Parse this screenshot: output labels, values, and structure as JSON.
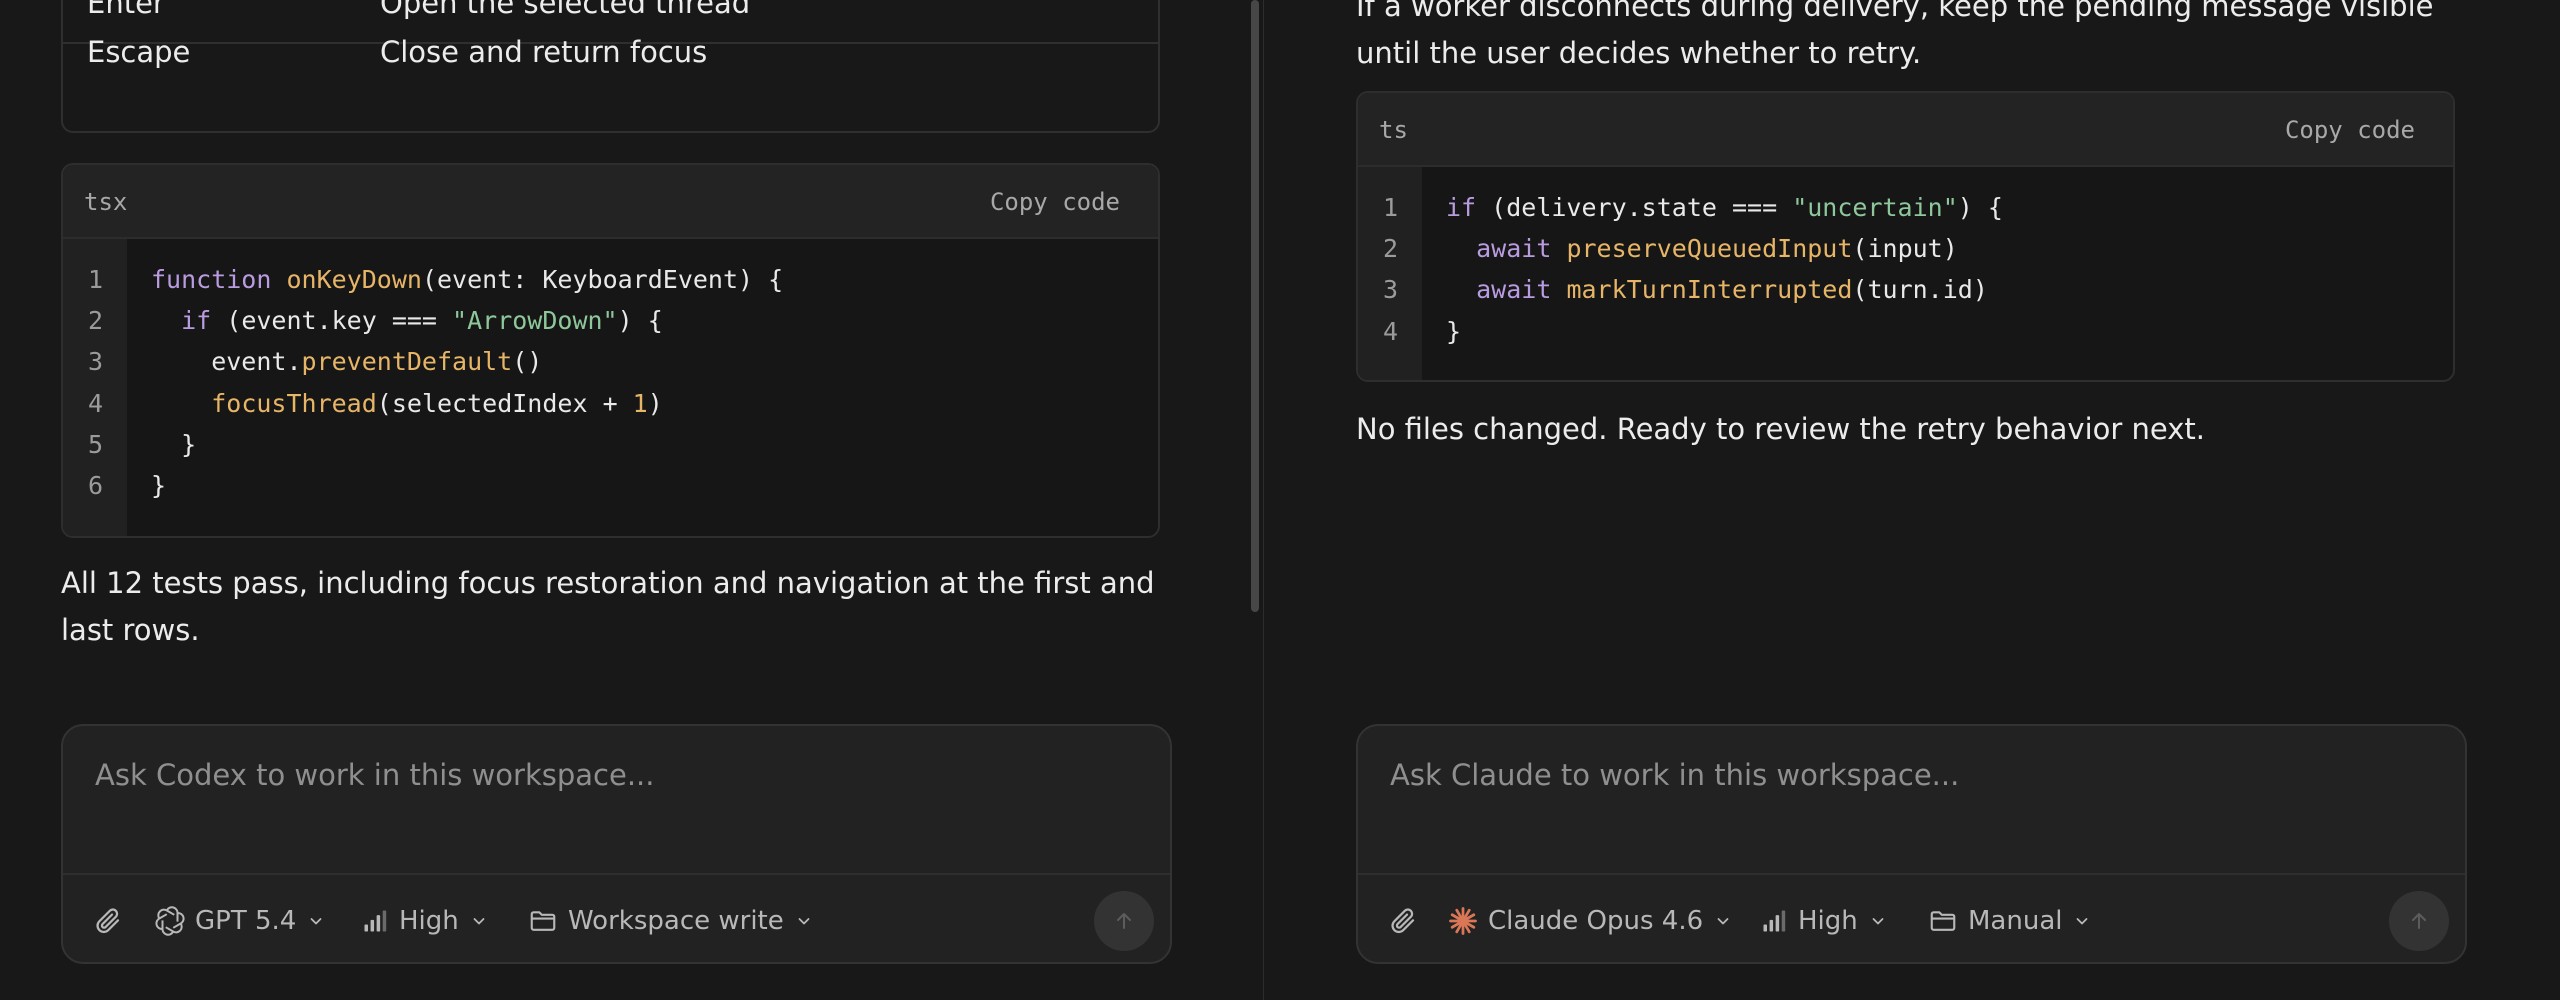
{
  "left_pane": {
    "shortcuts_table": {
      "rows": [
        {
          "key": "Enter",
          "action": "Open the selected thread"
        },
        {
          "key": "Escape",
          "action": "Close and return focus"
        }
      ]
    },
    "code_block": {
      "language": "tsx",
      "copy_label": "Copy code",
      "line_numbers": [
        "1",
        "2",
        "3",
        "4",
        "5",
        "6"
      ],
      "lines": [
        "function onKeyDown(event: KeyboardEvent) {",
        "  if (event.key === \"ArrowDown\") {",
        "    event.preventDefault()",
        "    focusThread(selectedIndex + 1)",
        "  }",
        "}"
      ]
    },
    "summary_lines": [
      "All 12 tests pass, including focus restoration and navigation at the first and",
      "last rows."
    ],
    "composer": {
      "placeholder": "Ask Codex to work in this workspace...",
      "model_label": "GPT 5.4",
      "effort_label": "High",
      "permission_label": "Workspace write"
    }
  },
  "right_pane": {
    "intro_lines": [
      "If a worker disconnects during delivery, keep the pending message visible",
      "until the user decides whether to retry."
    ],
    "code_block": {
      "language": "ts",
      "copy_label": "Copy code",
      "line_numbers": [
        "1",
        "2",
        "3",
        "4"
      ],
      "lines": [
        "if (delivery.state === \"uncertain\") {",
        "  await preserveQueuedInput(input)",
        "  await markTurnInterrupted(turn.id)",
        "}"
      ]
    },
    "status_text": "No files changed. Ready to review the retry behavior next.",
    "composer": {
      "placeholder": "Ask Claude to work in this workspace...",
      "model_label": "Claude Opus 4.6",
      "effort_label": "High",
      "permission_label": "Manual"
    }
  },
  "icons": {
    "attach": "paperclip-icon",
    "openai": "openai-logo-icon",
    "claude": "claude-logo-icon",
    "effort": "signal-bars-icon",
    "folder": "folder-icon",
    "chevron": "chevron-down-icon",
    "send": "arrow-up-icon"
  },
  "colors": {
    "background": "#181818",
    "keyword": "#b99be0",
    "function": "#e7b567",
    "string": "#8ec79a",
    "claude_accent": "#d97757"
  }
}
